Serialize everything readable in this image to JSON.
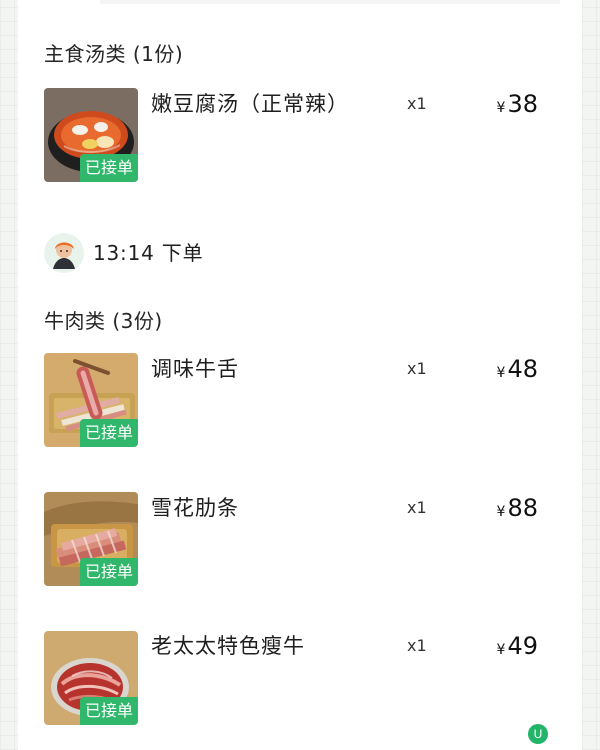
{
  "sections": [
    {
      "title": "主食汤类 (1份)",
      "items": [
        {
          "name": "嫩豆腐汤（正常辣）",
          "qty": "x1",
          "currency": "¥",
          "price": "38",
          "badge": "已接单"
        }
      ]
    },
    {
      "title": "牛肉类 (3份)",
      "items": [
        {
          "name": "调味牛舌",
          "qty": "x1",
          "currency": "¥",
          "price": "48",
          "badge": "已接单"
        },
        {
          "name": "雪花肋条",
          "qty": "x1",
          "currency": "¥",
          "price": "88",
          "badge": "已接单"
        },
        {
          "name": "老太太特色瘦牛",
          "qty": "x1",
          "currency": "¥",
          "price": "49",
          "badge": "已接单"
        }
      ]
    }
  ],
  "order_time": {
    "label": "13:14 下单",
    "avatar_icon": "user-avatar-icon"
  },
  "floating_icon": {
    "label": "U",
    "icon": "u-circle-icon"
  },
  "colors": {
    "badge_green": "#30b76b",
    "text_primary": "#1f1f1f",
    "page_bg": "#f3f5f3",
    "panel_bg": "#ffffff"
  }
}
